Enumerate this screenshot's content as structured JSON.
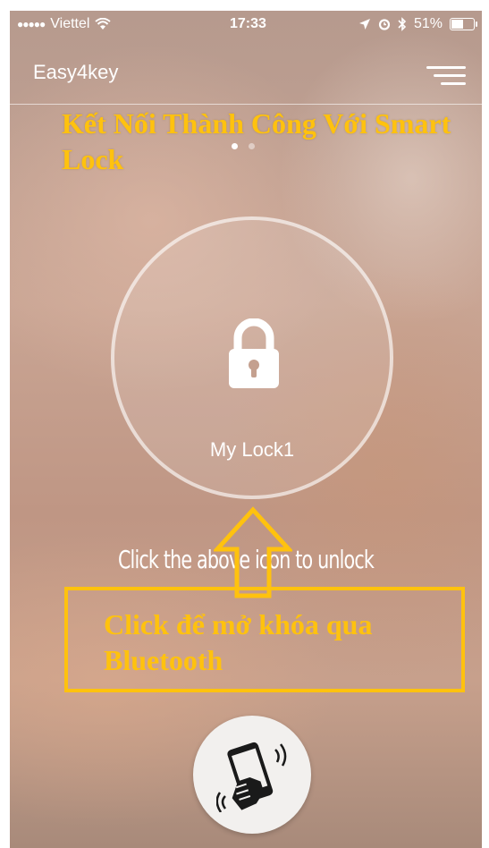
{
  "status_bar": {
    "signal": "●●●●●",
    "carrier": "Viettel",
    "wifi_icon": "wifi-icon",
    "time": "17:33",
    "battery": "51%"
  },
  "header": {
    "title": "Easy4key",
    "menu_icon": "hamburger-menu-icon"
  },
  "annotations": {
    "top_text": "Kết Nối Thành Công Với Smart Lock",
    "box_text": "Click để mở khóa qua Bluetooth",
    "color": "#ffc20e"
  },
  "pager": {
    "count": 2,
    "active": 1
  },
  "lock": {
    "name": "My Lock1",
    "icon": "padlock-icon"
  },
  "hint": "Click the above icon to unlock",
  "shake_button_icon": "phone-shake-icon"
}
